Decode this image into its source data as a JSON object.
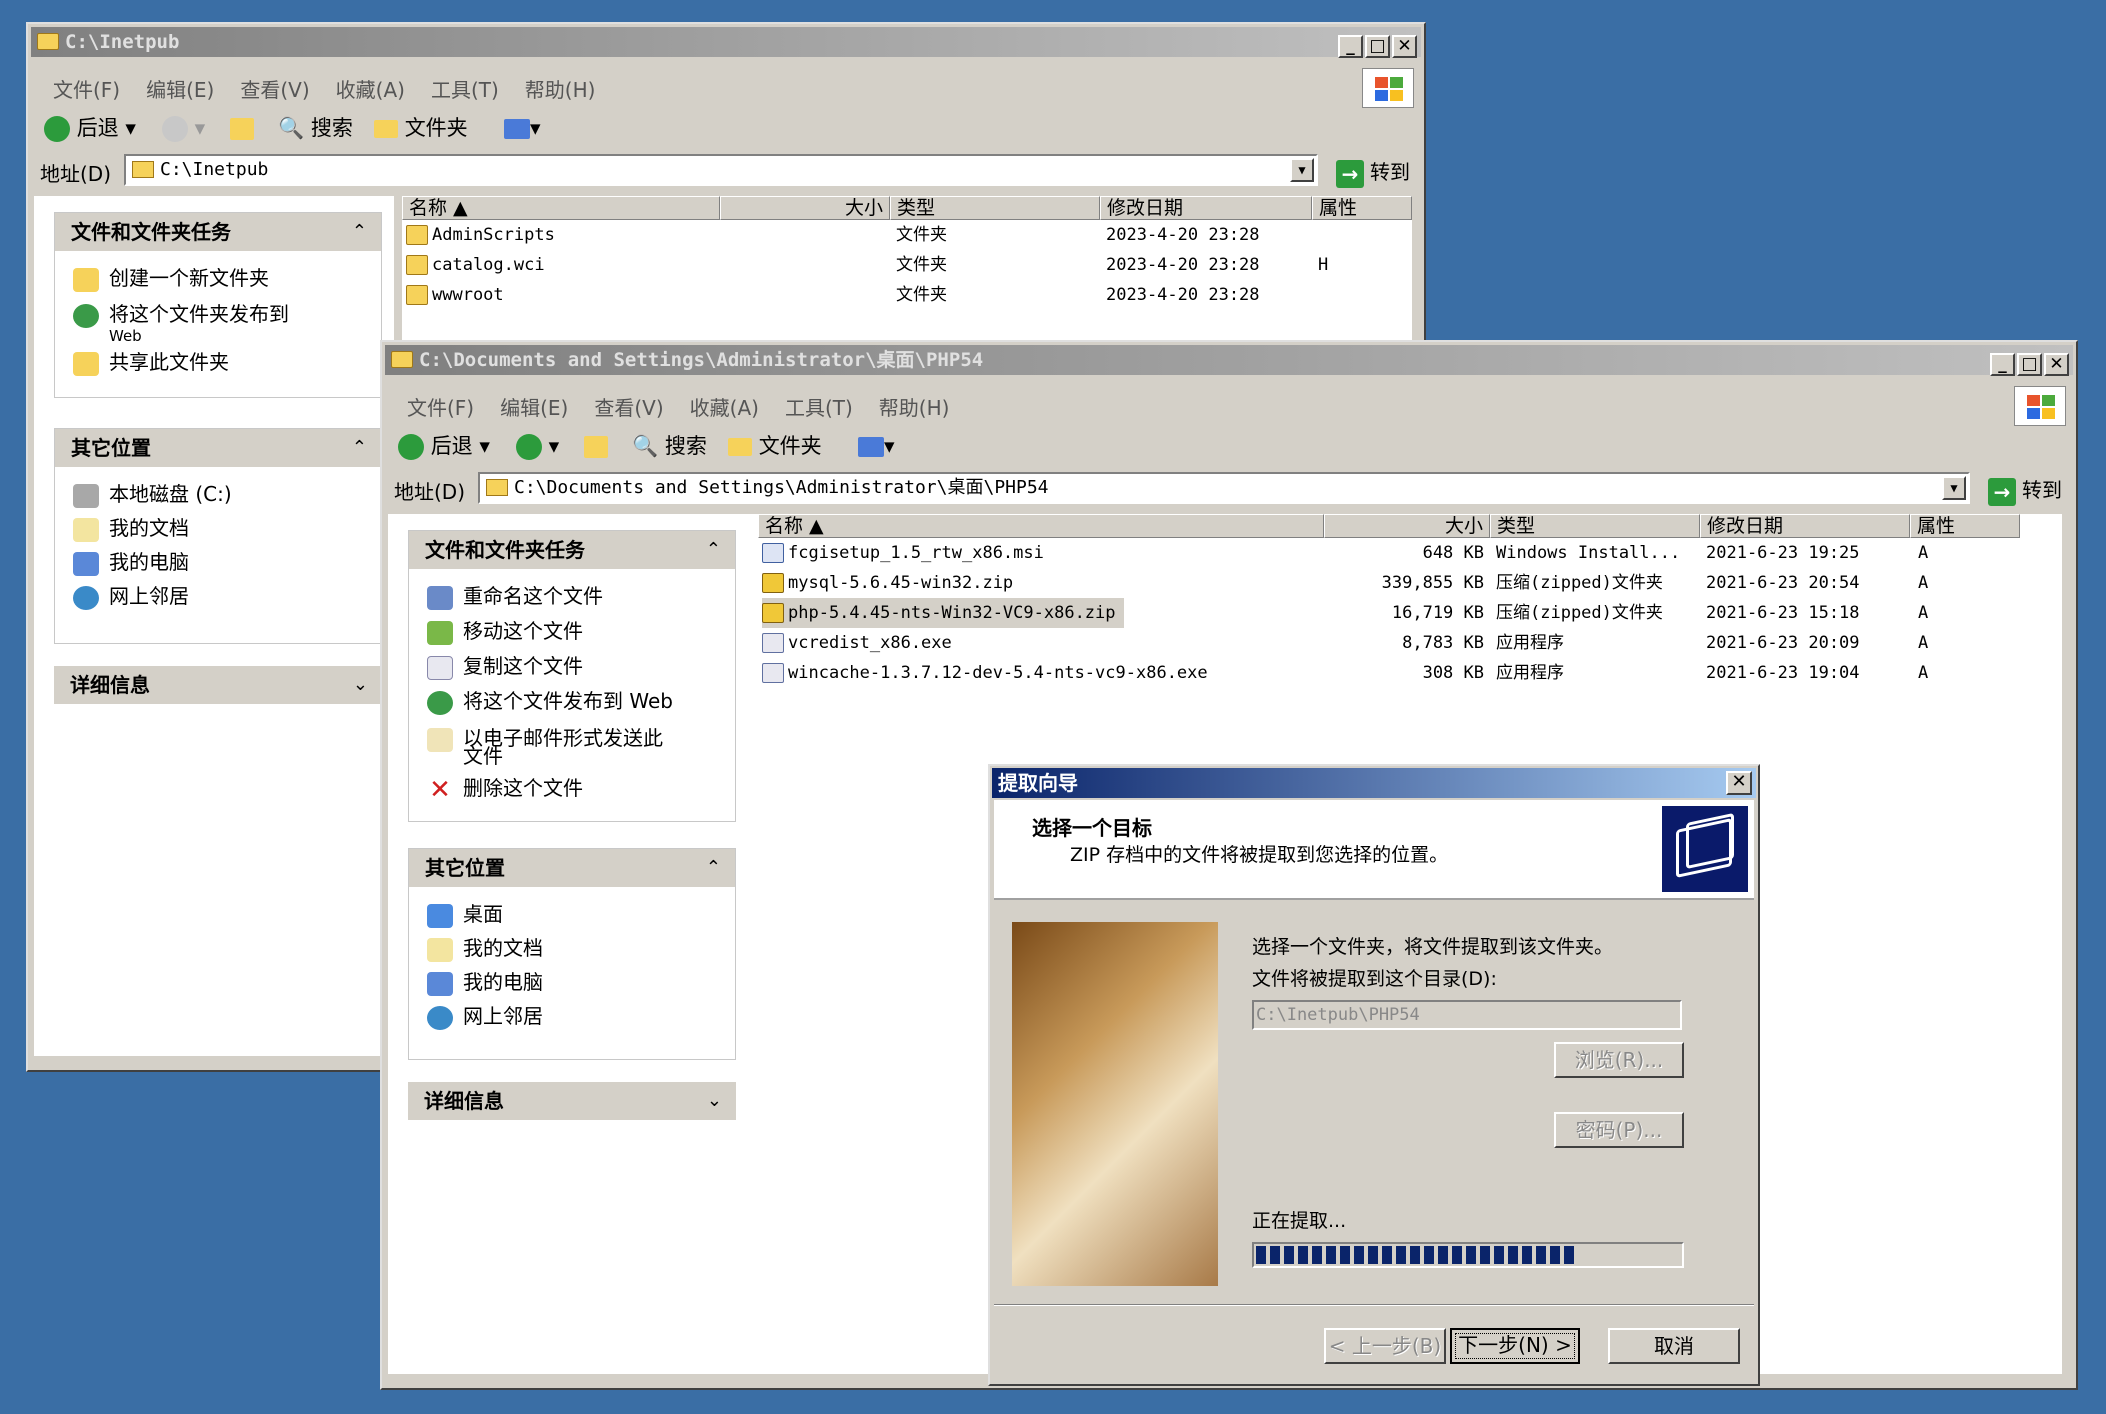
{
  "win1": {
    "title": "C:\\Inetpub",
    "menu": [
      "文件(F)",
      "编辑(E)",
      "查看(V)",
      "收藏(A)",
      "工具(T)",
      "帮助(H)"
    ],
    "toolbar": {
      "back": "后退",
      "search": "搜索",
      "folders": "文件夹"
    },
    "address": {
      "label": "地址(D)",
      "value": "C:\\Inetpub",
      "go": "转到"
    },
    "tasks": {
      "title": "文件和文件夹任务",
      "items": [
        "创建一个新文件夹",
        "将这个文件夹发布到",
        "Web",
        "共享此文件夹"
      ]
    },
    "other": {
      "title": "其它位置",
      "items": [
        "本地磁盘 (C:)",
        "我的文档",
        "我的电脑",
        "网上邻居"
      ]
    },
    "details": {
      "title": "详细信息"
    },
    "columns": [
      "名称 ▲",
      "大小",
      "类型",
      "修改日期",
      "属性"
    ],
    "files": [
      {
        "name": "AdminScripts",
        "size": "",
        "type": "文件夹",
        "date": "2023-4-20 23:28",
        "attr": ""
      },
      {
        "name": "catalog.wci",
        "size": "",
        "type": "文件夹",
        "date": "2023-4-20 23:28",
        "attr": "H"
      },
      {
        "name": "wwwroot",
        "size": "",
        "type": "文件夹",
        "date": "2023-4-20 23:28",
        "attr": ""
      }
    ]
  },
  "win2": {
    "title": "C:\\Documents and Settings\\Administrator\\桌面\\PHP54",
    "menu": [
      "文件(F)",
      "编辑(E)",
      "查看(V)",
      "收藏(A)",
      "工具(T)",
      "帮助(H)"
    ],
    "toolbar": {
      "back": "后退",
      "search": "搜索",
      "folders": "文件夹"
    },
    "address": {
      "label": "地址(D)",
      "value": "C:\\Documents and Settings\\Administrator\\桌面\\PHP54",
      "go": "转到"
    },
    "tasks": {
      "title": "文件和文件夹任务",
      "items": [
        "重命名这个文件",
        "移动这个文件",
        "复制这个文件",
        "将这个文件发布到 Web",
        "以电子邮件形式发送此",
        "文件",
        "删除这个文件"
      ]
    },
    "other": {
      "title": "其它位置",
      "items": [
        "桌面",
        "我的文档",
        "我的电脑",
        "网上邻居"
      ]
    },
    "details": {
      "title": "详细信息"
    },
    "columns": [
      "名称 ▲",
      "大小",
      "类型",
      "修改日期",
      "属性"
    ],
    "files": [
      {
        "name": "fcgisetup_1.5_rtw_x86.msi",
        "size": "648 KB",
        "type": "Windows Install...",
        "date": "2021-6-23 19:25",
        "attr": "A"
      },
      {
        "name": "mysql-5.6.45-win32.zip",
        "size": "339,855 KB",
        "type": "压缩(zipped)文件夹",
        "date": "2021-6-23 20:54",
        "attr": "A"
      },
      {
        "name": "php-5.4.45-nts-Win32-VC9-x86.zip",
        "size": "16,719 KB",
        "type": "压缩(zipped)文件夹",
        "date": "2021-6-23 15:18",
        "attr": "A"
      },
      {
        "name": "vcredist_x86.exe",
        "size": "8,783 KB",
        "type": "应用程序",
        "date": "2021-6-23 20:09",
        "attr": "A"
      },
      {
        "name": "wincache-1.3.7.12-dev-5.4-nts-vc9-x86.exe",
        "size": "308 KB",
        "type": "应用程序",
        "date": "2021-6-23 19:04",
        "attr": "A"
      }
    ]
  },
  "dialog": {
    "title": "提取向导",
    "heading": "选择一个目标",
    "subheading": "ZIP 存档中的文件将被提取到您选择的位置。",
    "instruction": "选择一个文件夹，将文件提取到该文件夹。",
    "dir_label": "文件将被提取到这个目录(D):",
    "dir_value": "C:\\Inetpub\\PHP54",
    "browse": "浏览(R)...",
    "password": "密码(P)...",
    "status": "正在提取...",
    "progress": 0.75,
    "back": "< 上一步(B)",
    "next": "下一步(N) >",
    "cancel": "取消"
  }
}
